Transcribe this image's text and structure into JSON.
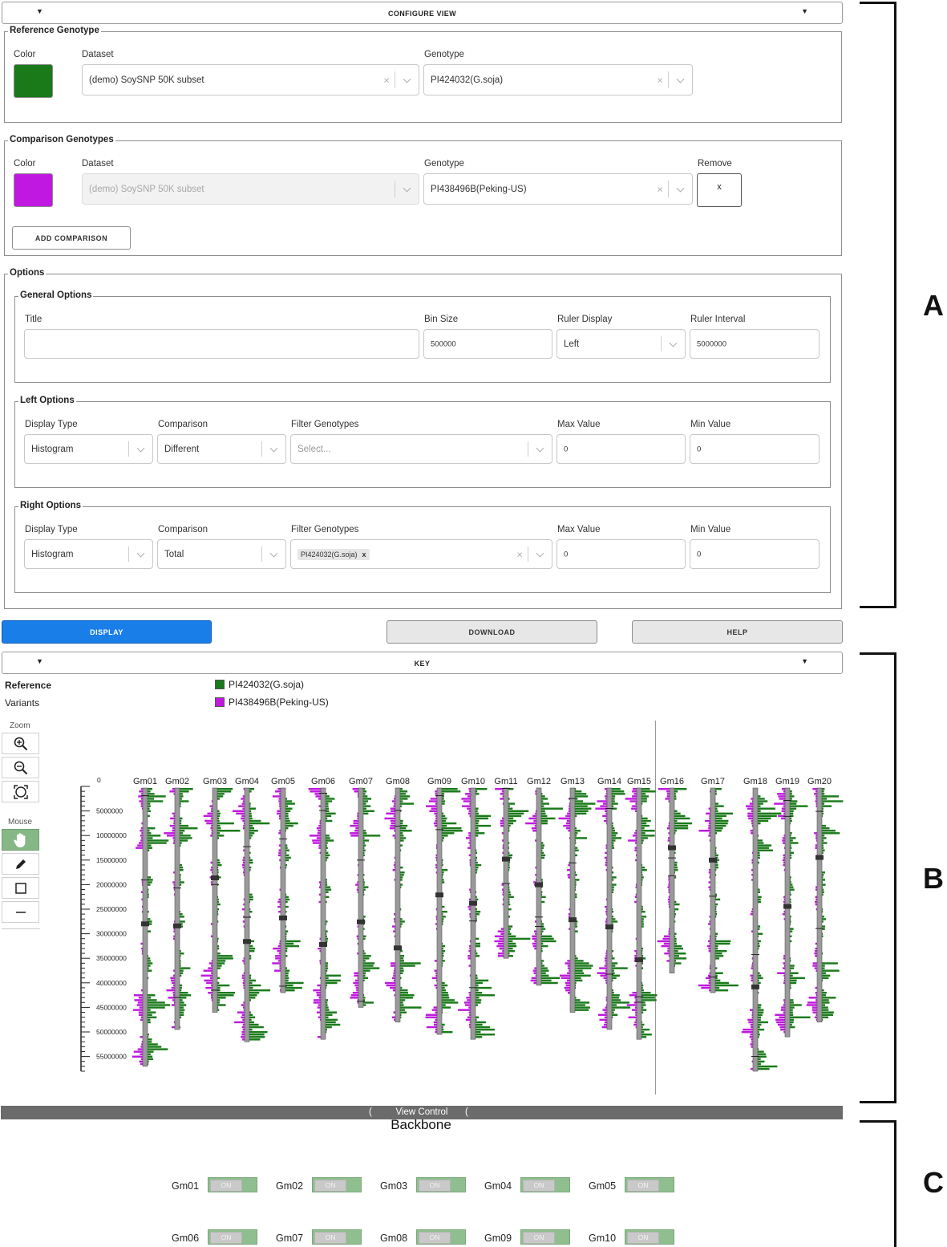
{
  "configure_view": {
    "title": "CONFIGURE VIEW"
  },
  "reference_genotype": {
    "legend": "Reference Genotype",
    "color_label": "Color",
    "color": "#1a7a1a",
    "dataset_label": "Dataset",
    "dataset_value": "(demo) SoyS‌NP 50K subset",
    "genotype_label": "Genotype",
    "genotype_value": "PI424032(G.soja)"
  },
  "comparison_genotypes": {
    "legend": "Comparison Genotypes",
    "color_label": "Color",
    "color": "#c018e0",
    "dataset_label": "Dataset",
    "dataset_value": "(demo) SoySNP 50K subset",
    "genotype_label": "Genotype",
    "genotype_value": "PI438496B(Peking-US)",
    "remove_label": "Remove",
    "remove_button": "x",
    "add_button": "ADD COMPARISON"
  },
  "options": {
    "legend": "Options",
    "general": {
      "legend": "General Options",
      "title_label": "Title",
      "title_value": "",
      "bin_size_label": "Bin Size",
      "bin_size_value": "500000",
      "ruler_display_label": "Ruler Display",
      "ruler_display_value": "Left",
      "ruler_interval_label": "Ruler Interval",
      "ruler_interval_value": "5000000"
    },
    "left": {
      "legend": "Left Options",
      "display_type_label": "Display Type",
      "display_type_value": "Histogram",
      "comparison_label": "Comparison",
      "comparison_value": "Different",
      "filter_label": "Filter Genotypes",
      "filter_placeholder": "Select...",
      "max_label": "Max Value",
      "max_value": "0",
      "min_label": "Min Value",
      "min_value": "0"
    },
    "right": {
      "legend": "Right Options",
      "display_type_label": "Display Type",
      "display_type_value": "Histogram",
      "comparison_label": "Comparison",
      "comparison_value": "Total",
      "filter_label": "Filter Genotypes",
      "filter_tag": "PI424032(G.soja)",
      "filter_tag_remove": "x",
      "max_label": "Max Value",
      "max_value": "0",
      "min_label": "Min Value",
      "min_value": "0"
    }
  },
  "actions": {
    "display": "DISPLAY",
    "download": "DOWNLOAD",
    "help": "HELP"
  },
  "key": {
    "title": "KEY",
    "reference_label": "Reference",
    "reference_genotype": "PI424032(G.soja)",
    "reference_color": "#1a7a1a",
    "variants_label": "Variants",
    "variant_genotype": "PI438496B(Peking-US)",
    "variant_color": "#c018e0"
  },
  "toolbar": {
    "zoom_label": "Zoom",
    "zoom_icons": [
      "zoom-in-icon",
      "zoom-out-icon",
      "reset-view-icon"
    ],
    "mouse_label": "Mouse",
    "mouse_icons": [
      "hand-icon",
      "pencil-icon",
      "square-icon",
      "line-icon"
    ]
  },
  "chart_data": {
    "type": "bar",
    "description_colors": {
      "reference": "#1a7a1a",
      "variants": "#c018e0"
    },
    "ruler_ticks": [
      "0",
      "5000000",
      "10000000",
      "15000000",
      "20000000",
      "25000000",
      "30000000",
      "35000000",
      "40000000",
      "45000000",
      "50000000",
      "55000000"
    ],
    "chromosomes": [
      {
        "name": "Gm01",
        "length": 57
      },
      {
        "name": "Gm02",
        "length": 49.5
      },
      {
        "name": "Gm03",
        "length": 46
      },
      {
        "name": "Gm04",
        "length": 52
      },
      {
        "name": "Gm05",
        "length": 42
      },
      {
        "name": "Gm06",
        "length": 51.5
      },
      {
        "name": "Gm07",
        "length": 45
      },
      {
        "name": "Gm08",
        "length": 48
      },
      {
        "name": "Gm09",
        "length": 50.5
      },
      {
        "name": "Gm10",
        "length": 51.5
      },
      {
        "name": "Gm11",
        "length": 35
      },
      {
        "name": "Gm12",
        "length": 40.5
      },
      {
        "name": "Gm13",
        "length": 46
      },
      {
        "name": "Gm14",
        "length": 49.5
      },
      {
        "name": "Gm15",
        "length": 51.5
      },
      {
        "name": "Gm16",
        "length": 38
      },
      {
        "name": "Gm17",
        "length": 42
      },
      {
        "name": "Gm18",
        "length": 58
      },
      {
        "name": "Gm19",
        "length": 51
      },
      {
        "name": "Gm20",
        "length": 48
      }
    ]
  },
  "view_control": {
    "bar_label": "View Control",
    "heading": "Backbone",
    "toggles": [
      {
        "name": "Gm01",
        "state": "ON"
      },
      {
        "name": "Gm02",
        "state": "ON"
      },
      {
        "name": "Gm03",
        "state": "ON"
      },
      {
        "name": "Gm04",
        "state": "ON"
      },
      {
        "name": "Gm05",
        "state": "ON"
      },
      {
        "name": "Gm06",
        "state": "ON"
      },
      {
        "name": "Gm07",
        "state": "ON"
      },
      {
        "name": "Gm08",
        "state": "ON"
      },
      {
        "name": "Gm09",
        "state": "ON"
      },
      {
        "name": "Gm10",
        "state": "ON"
      }
    ]
  },
  "panel_letters": {
    "a": "A",
    "b": "B",
    "c": "C"
  }
}
